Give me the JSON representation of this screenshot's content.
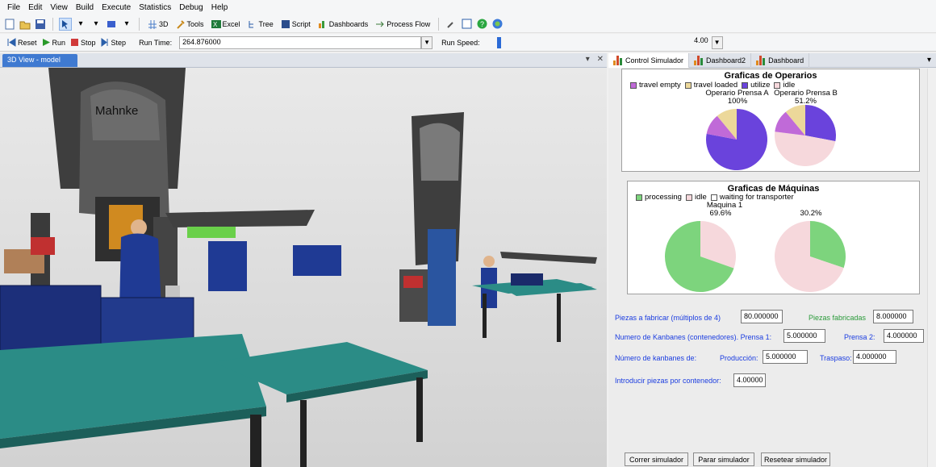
{
  "menu": [
    "File",
    "Edit",
    "View",
    "Build",
    "Execute",
    "Statistics",
    "Debug",
    "Help"
  ],
  "toolbar": {
    "view3d": "3D",
    "tools": "Tools",
    "excel": "Excel",
    "tree": "Tree",
    "script": "Script",
    "dashboards": "Dashboards",
    "process_flow": "Process Flow"
  },
  "runbar": {
    "reset": "Reset",
    "run": "Run",
    "stop": "Stop",
    "step": "Step",
    "run_time_label": "Run Time:",
    "run_time_value": "264.876000",
    "run_speed_label": "Run Speed:",
    "run_speed_value": "4.00"
  },
  "view_tab": "3D View - model",
  "viewport": {
    "machine_label": "Mahnke"
  },
  "right_tabs": [
    "Control Simulador",
    "Dashboard2",
    "Dashboard"
  ],
  "chart_data": [
    {
      "type": "pie",
      "title": "Graficas de Operarios",
      "legend": [
        "travel empty",
        "travel loaded",
        "utilize",
        "idle"
      ],
      "colors": {
        "travel empty": "#c06ad8",
        "travel loaded": "#ecd89a",
        "utilize": "#6a43dc",
        "idle": "#f6d8dc"
      },
      "pies": [
        {
          "name": "Operario Prensa A",
          "value_label": "100%",
          "slices": {
            "utilize": 0.78,
            "travel loaded": 0.11,
            "travel empty": 0.11
          }
        },
        {
          "name": "Operario Prensa B",
          "value_label": "51.2%",
          "slices": {
            "utilize": 0.28,
            "idle": 0.49,
            "travel empty": 0.12,
            "travel loaded": 0.11
          }
        }
      ]
    },
    {
      "type": "pie",
      "title": "Graficas de Máquinas",
      "legend": [
        "processing",
        "idle",
        "waiting for transporter"
      ],
      "colors": {
        "processing": "#7dd47d",
        "idle": "#f6d8dc",
        "waiting for transporter": "#ffffff"
      },
      "pies": [
        {
          "name": "Maquina 1",
          "value_label": "69.6%",
          "slices": {
            "processing": 0.696,
            "idle": 0.304
          }
        },
        {
          "name": "",
          "value_label": "30.2%",
          "slices": {
            "processing": 0.302,
            "idle": 0.698
          }
        }
      ]
    }
  ],
  "form": {
    "piezas_label": "Piezas a fabricar (múltiplos de 4)",
    "piezas_value": "80.000000",
    "fabricadas_label": "Piezas fabricadas",
    "fabricadas_value": "8.000000",
    "kanbanes_label": "Numero de Kanbanes (contenedores). Prensa 1:",
    "prensa1_value": "5.000000",
    "prensa2_label": "Prensa 2:",
    "prensa2_value": "4.000000",
    "num_kanbanes_label": "Número de kanbanes de:",
    "produccion_label": "Producción:",
    "produccion_value": "5.000000",
    "traspaso_label": "Traspaso:",
    "traspaso_value": "4.000000",
    "introducir_label": "Introducir piezas por contenedor:",
    "introducir_value": "4.00000",
    "btn_correr": "Correr simulador",
    "btn_parar": "Parar simulador",
    "btn_resetear": "Resetear simulador"
  }
}
